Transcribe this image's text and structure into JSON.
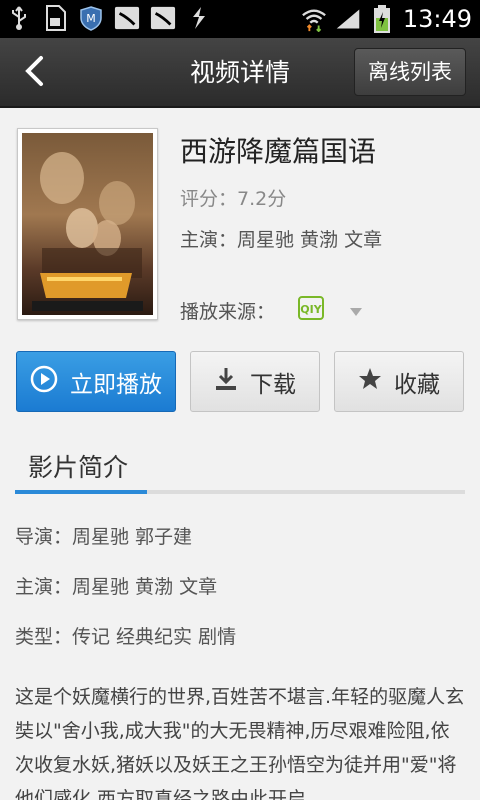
{
  "status_bar": {
    "time": "13:49",
    "icons": [
      "usb-icon",
      "sd-card-icon",
      "shield-icon",
      "leaf-icon",
      "leaf-icon",
      "transfer-icon",
      "wifi-icon",
      "signal-icon",
      "battery-charging-icon"
    ]
  },
  "header": {
    "title": "视频详情",
    "offline_label": "离线列表",
    "back_icon": "back-chevron-icon"
  },
  "movie": {
    "title": "西游降魔篇国语",
    "rating": "评分：7.2分",
    "cast": "主演：周星驰  黄渤  文章",
    "source_label": "播放来源：",
    "source_icon": "iqiyi-logo-icon",
    "accent_color": "#2b8ad8"
  },
  "actions": {
    "play_label": "立即播放",
    "download_label": "下载",
    "favorite_label": "收藏"
  },
  "tabs": {
    "intro_label": "影片简介"
  },
  "details": {
    "director": "导演：周星驰  郭子建",
    "cast": "主演：周星驰  黄渤  文章",
    "genre": "类型：传记  经典纪实  剧情",
    "synopsis": "这是个妖魔横行的世界,百姓苦不堪言.年轻的驱魔人玄奘以\"舍小我,成大我\"的大无畏精神,历尽艰难险阻,依次收复水妖,猪妖以及妖王之王孙悟空为徒并用\"爱\"将他们感化,西方取真经之路由此开启"
  }
}
